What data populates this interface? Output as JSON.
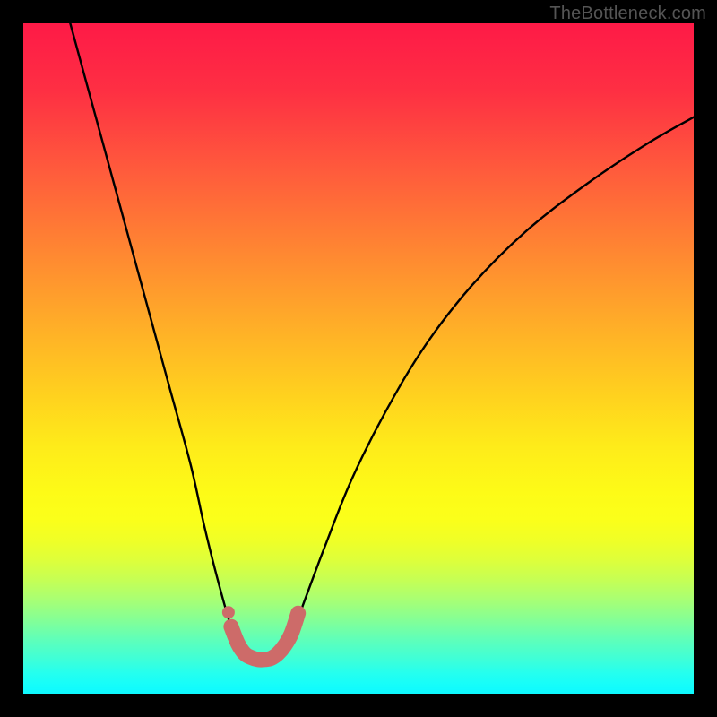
{
  "watermark": "TheBottleneck.com",
  "colors": {
    "gradient_top": "#fe1a47",
    "gradient_bottom": "#0ef8ff",
    "curve": "#000000",
    "marker": "#cd6b69",
    "frame_border": "#000000"
  },
  "chart_data": {
    "type": "line",
    "title": "",
    "xlabel": "",
    "ylabel": "",
    "xlim": [
      0,
      100
    ],
    "ylim": [
      0,
      100
    ],
    "series": [
      {
        "name": "bottleneck-curve",
        "x": [
          7,
          10,
          13,
          16,
          19,
          22,
          25,
          27,
          29,
          31,
          32.5,
          34,
          35,
          36,
          37,
          38.5,
          40.5,
          42,
          45,
          49,
          54,
          60,
          67,
          75,
          84,
          93,
          100
        ],
        "values": [
          100,
          89,
          78,
          67,
          56,
          45,
          34,
          25,
          17,
          10,
          7,
          5.5,
          5.1,
          5.1,
          5.3,
          6.5,
          10,
          14,
          22,
          32,
          42,
          52,
          61,
          69,
          76,
          82,
          86
        ]
      }
    ],
    "markers": {
      "name": "highlighted-region",
      "style": "thick-dots",
      "x": [
        31,
        32,
        33,
        34,
        35,
        36,
        37,
        38,
        39,
        40,
        41
      ],
      "values": [
        10,
        7.5,
        6,
        5.4,
        5.1,
        5.1,
        5.3,
        6,
        7.2,
        9,
        12
      ]
    }
  }
}
